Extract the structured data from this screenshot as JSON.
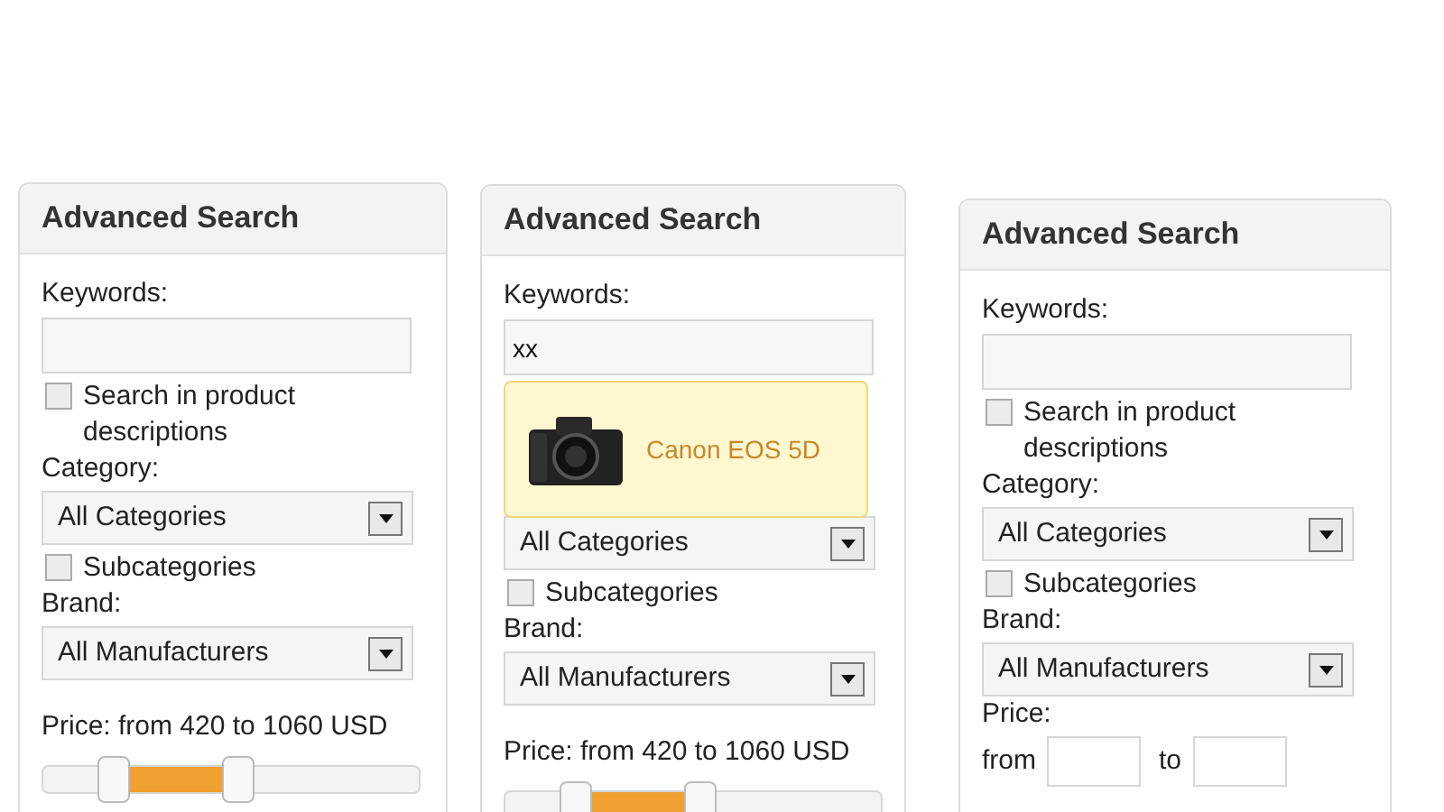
{
  "panels": [
    {
      "title": "Advanced Search",
      "fields": [
        {
          "kind": "text",
          "label": "Keywords:"
        },
        {
          "kind": "checkbox",
          "label": "Search in product descriptions",
          "checked": false
        },
        {
          "kind": "select",
          "label": "Category:",
          "value": "All Categories"
        },
        {
          "kind": "checkbox",
          "label": "Subcategories",
          "checked": false
        },
        {
          "kind": "select",
          "label": "Brand:",
          "value": "All Manufacturers"
        },
        {
          "kind": "slider",
          "label": "Price: from 420 to 1060 USD",
          "low": {
            "level": 0.19
          },
          "high": {
            "level": 0.52
          }
        }
      ]
    },
    {
      "title": "Advanced Search",
      "fields": [
        {
          "kind": "text",
          "label": "Keywords:",
          "value": "xx"
        },
        {
          "kind": "suggestion",
          "label": "Canon EOS 5D"
        },
        {
          "kind": "select",
          "value": "All Categories"
        },
        {
          "kind": "checkbox",
          "label": "Subcategories",
          "checked": false
        },
        {
          "kind": "select",
          "label": "Brand:",
          "value": "All Manufacturers"
        },
        {
          "kind": "slider",
          "label": "Price: from 420 to 1060 USD",
          "low": {
            "level": 0.19
          },
          "high": {
            "level": 0.52
          }
        }
      ]
    },
    {
      "title": "Advanced Search",
      "fields": [
        {
          "kind": "text",
          "label": "Keywords:"
        },
        {
          "kind": "checkbox",
          "label": "Search in product descriptions",
          "checked": false
        },
        {
          "kind": "select",
          "label": "Category:",
          "value": "All Categories"
        },
        {
          "kind": "checkbox",
          "label": "Subcategories",
          "checked": false
        },
        {
          "kind": "select",
          "label": "Brand:",
          "value": "All Manufacturers"
        },
        {
          "kind": "range_inputs",
          "label": "Price:",
          "from_label": "from",
          "to_label": "to"
        }
      ]
    }
  ]
}
